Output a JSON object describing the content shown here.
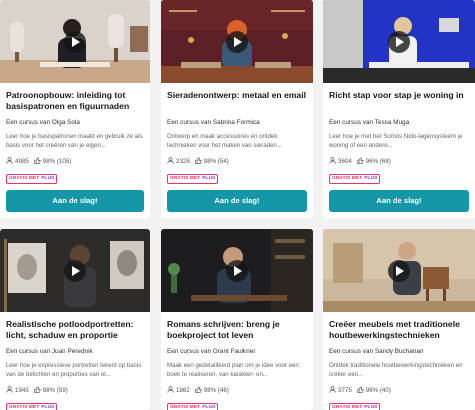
{
  "courses": [
    {
      "title": "Patroonopbouw: inleiding tot basispatronen en figuurnaden",
      "author": "Een cursus van Olga Sola",
      "description": "Leer hoe je basispatronen maakt en gebruik ze als basis voor het creëren van je eigen...",
      "students": "4985",
      "rating": "98% (105)",
      "cta": "Aan de slag!"
    },
    {
      "title": "Sieradenontwerp: metaal en email",
      "author": "Een cursus van Sabrina Formica",
      "description": "Ontwerp en maak accessoires en ontdek technieken voor het maken van sieraden...",
      "students": "2328",
      "rating": "98% (54)",
      "cta": "Aan de slag!"
    },
    {
      "title": "Richt stap voor stap je woning in",
      "author": "Een cursus van Tessa Muga",
      "description": "Leer hoe je met het Somos Nido-lagensysteem je woning of een andere...",
      "students": "3604",
      "rating": "96% (68)",
      "cta": "Aan de slag!"
    },
    {
      "title": "Realistische potloodportretten: licht, schaduw en proportie",
      "author": "Een cursus van Juan Perednik",
      "description": "Leer hoe je expressieve portretten tekent op basis van de belichten en proporties van el...",
      "students": "1945",
      "rating": "98% (59)"
    },
    {
      "title": "Romans schrijven: breng je boekproject tot leven",
      "author": "Een cursus van Grant Faulkner",
      "description": "Maak een gedetailleerd plan om je idee voor een boek te realiseren, van karakter- en...",
      "students": "1862",
      "rating": "98% (46)"
    },
    {
      "title": "Creëer meubels met traditionele houtbewerkingstechnieken",
      "author": "Een cursus van Sandy Buchanan",
      "description": "Ontdek traditionele houtbewerkingstechnieken en creëer een...",
      "students": "3775",
      "rating": "98% (40)"
    }
  ],
  "badge": {
    "free": "GRATIS MET",
    "plus": "PLUS"
  },
  "icons": {
    "students": "person-icon",
    "rating": "thumbs-up-icon",
    "play": "play-icon"
  },
  "colors": {
    "accent": "#1597a8",
    "badge_free": "#e8336b",
    "badge_plus": "#7b3fe4"
  }
}
